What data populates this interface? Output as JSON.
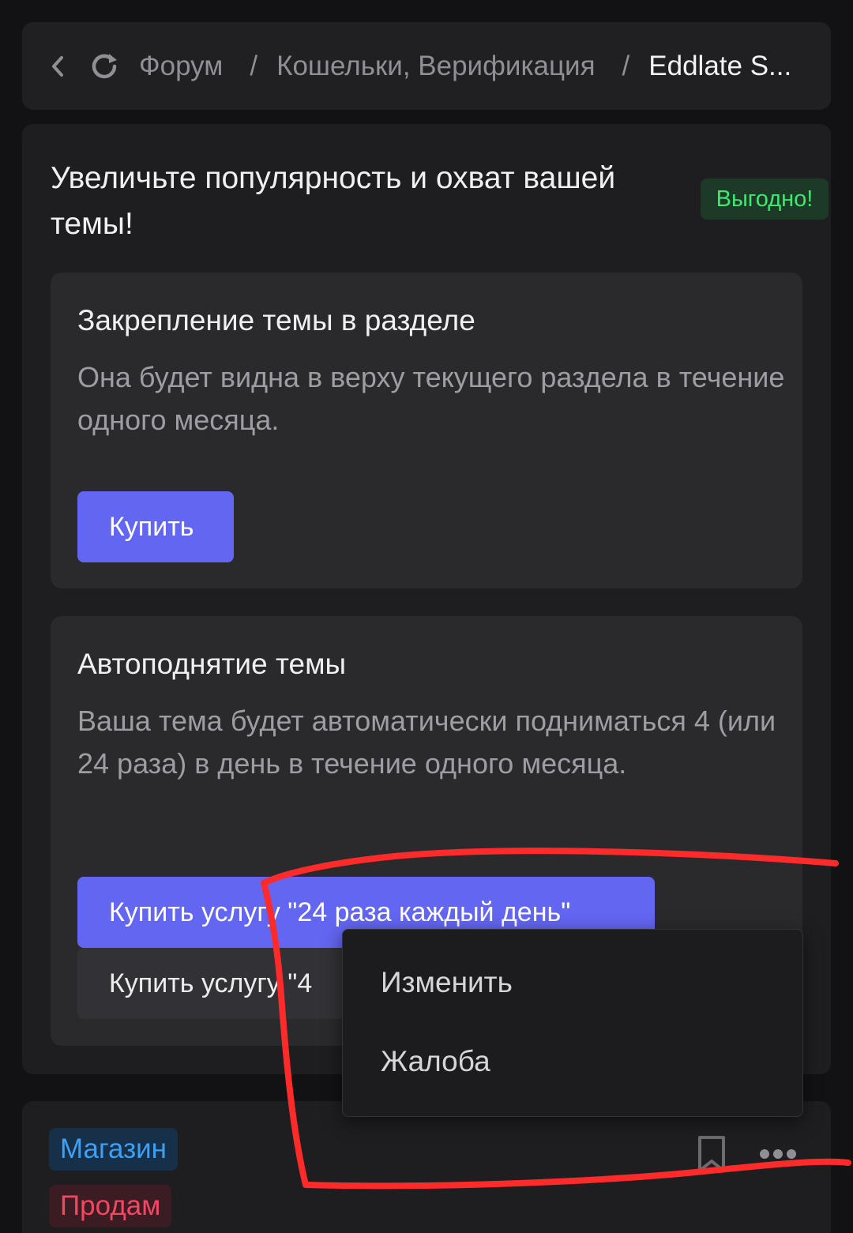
{
  "breadcrumb": {
    "items": [
      "Форум",
      "Кошельки, Верификация",
      "Eddlate S..."
    ],
    "separator": "/"
  },
  "promo": {
    "title": "Увеличьте популярность и охват вашей темы!",
    "badge": "Выгодно!",
    "pin_card": {
      "title": "Закрепление темы в разделе",
      "description": "Она будет видна в верху текущего раздела в течение одного месяца.",
      "buy_label": "Купить"
    },
    "bump_card": {
      "title": "Автоподнятие темы",
      "description": "Ваша тема будет автоматически подниматься 4 (или 24 раза) в день в течение одного месяца.",
      "buy24_label": "Купить услугу \"24 раза каждый день\"",
      "buy4_label": "Купить услугу \"4"
    }
  },
  "context_menu": {
    "items": [
      "Изменить",
      "Жалоба"
    ]
  },
  "thread": {
    "tags": [
      "Магазин",
      "Продам"
    ],
    "icons": [
      "bookmark-icon",
      "more-icon"
    ]
  },
  "colors": {
    "accent": "#6366f1",
    "badge_green": "#3ee872",
    "tag_blue": "#3f9ff2",
    "tag_red": "#f24863",
    "annotation_red": "#ff2a2a"
  }
}
